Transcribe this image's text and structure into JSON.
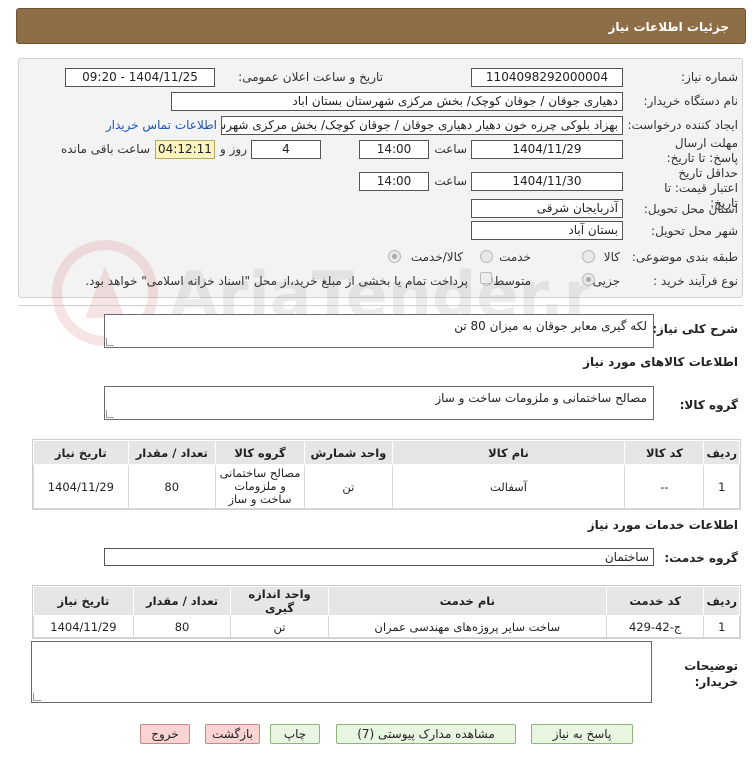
{
  "header": {
    "title": "جزئیات اطلاعات نیاز"
  },
  "form": {
    "need_number_label": "شماره نیاز:",
    "need_number": "1104098292000004",
    "announce_label": "تاریخ و ساعت اعلان عمومی:",
    "announce_value": "1404/11/25 - 09:20",
    "buyer_org_label": "نام دستگاه خریدار:",
    "buyer_org": "دهیاری جوقان / جوقان کوچک/ بخش مرکزی شهرستان بستان اباد",
    "requester_label": "ایجاد کننده درخواست:",
    "requester": "بهزاد بلوکی چرزه خون دهیار دهیاری جوقان / جوقان کوچک/ بخش مرکزی شهرستان بستان اباد",
    "contact_link": "اطلاعات تماس خریدار",
    "reply_deadline_label": "مهلت ارسال پاسخ: تا تاریخ:",
    "reply_date": "1404/11/29",
    "time_label": "ساعت",
    "reply_time": "14:00",
    "days_value": "4",
    "days_and_label": "روز و",
    "remaining_timer": "04:12:11",
    "remaining_label": "ساعت باقی مانده",
    "validity_label": "حداقل تاریخ اعتبار قیمت: تا تاریخ:",
    "validity_date": "1404/11/30",
    "validity_time": "14:00",
    "province_label": "استان محل تحویل:",
    "province": "آذربایجان شرقی",
    "city_label": "شهر محل تحویل:",
    "city": "بستان آباد",
    "category_label": "طبقه بندی موضوعی:",
    "category_options": [
      "کالا",
      "خدمت",
      "کالا/خدمت"
    ],
    "process_label": "نوع فرآیند خرید :",
    "process_options": [
      "جزیی",
      "متوسط"
    ],
    "payment_note": "پرداخت تمام یا بخشی از مبلغ خرید،از محل \"اسناد خزانه اسلامی\" خواهد بود."
  },
  "watermark": {
    "text": "AriaTender.net"
  },
  "summary": {
    "label": "شرح کلی نیاز:",
    "value": "لکه گیری معابر جوقان به میزان 80 تن"
  },
  "goods": {
    "section_title": "اطلاعات کالاهای مورد نیاز",
    "group_label": "گروه کالا:",
    "group_value": "مصالح ساختمانی و ملزومات ساخت و ساز",
    "columns": [
      "ردیف",
      "کد کالا",
      "نام کالا",
      "واحد شمارش",
      "گروه کالا",
      "تعداد / مقدار",
      "تاریخ نیاز"
    ],
    "rows": [
      [
        "1",
        "--",
        "آسفالت",
        "تن",
        "مصالح ساختمانی و ملزومات ساخت و ساز",
        "80",
        "1404/11/29"
      ]
    ]
  },
  "services": {
    "section_title": "اطلاعات خدمات مورد نیاز",
    "group_label": "گروه خدمت:",
    "group_value": "ساختمان",
    "columns": [
      "ردیف",
      "کد خدمت",
      "نام خدمت",
      "واحد اندازه گیری",
      "تعداد / مقدار",
      "تاریخ نیاز"
    ],
    "rows": [
      [
        "1",
        "ج-42-429",
        "ساخت سایر پروژه‌های مهندسی عمران",
        "تن",
        "80",
        "1404/11/29"
      ]
    ]
  },
  "buyer_notes": {
    "label": "توضیحات خریدار:",
    "value": ""
  },
  "buttons": {
    "reply": "پاسخ به نیاز",
    "attachments": "مشاهده مدارک پیوستی (7)",
    "print": "چاپ",
    "back": "بازگشت",
    "exit": "خروج"
  },
  "colors": {
    "header_bg": "#8e6e46",
    "timer_bg": "#fdf3bf",
    "button_green": "#e8f5e0",
    "button_red": "#fad3d3",
    "link": "#1a57b5"
  }
}
